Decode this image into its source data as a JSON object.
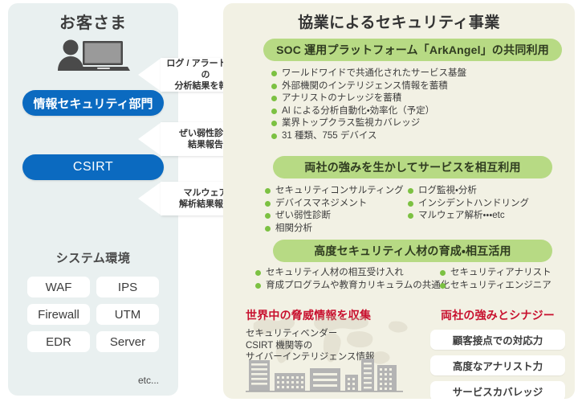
{
  "left": {
    "title": "お客さま",
    "icon_name": "person-at-laptop-icon",
    "departments": [
      {
        "label": "情報セキュリティ部門"
      },
      {
        "label": "CSIRT"
      }
    ],
    "system_env": {
      "title": "システム環境",
      "items": [
        "WAF",
        "IPS",
        "Firewall",
        "UTM",
        "EDR",
        "Server"
      ],
      "etc_label": "etc..."
    }
  },
  "callouts": [
    {
      "text": "ログ / アラート情報の\n分析結果を報告"
    },
    {
      "text": "ぜい弱性診断\n結果報告"
    },
    {
      "text": "マルウェア\n解析結果報告"
    }
  ],
  "right": {
    "title": "協業によるセキュリティ事業",
    "sections": [
      {
        "heading": "SOC 運用プラットフォーム「ArkAngel」の共同利用",
        "columns": [
          [
            "ワールドワイドで共通化されたサービス基盤",
            "外部機関のインテリジェンス情報を蓄積",
            "アナリストのナレッジを蓄積",
            "AI による分析自動化・効率化（予定）",
            "業界トップクラス監視カバレッジ",
            "31 種類、755 デバイス"
          ]
        ]
      },
      {
        "heading": "両社の強みを生かしてサービスを相互利用",
        "columns": [
          [
            "セキュリティコンサルティング",
            "デバイスマネジメント",
            "ぜい弱性診断",
            "相関分析"
          ],
          [
            "ログ監視・分析",
            "インシデントハンドリング",
            "マルウェア解析・・・etc"
          ]
        ]
      },
      {
        "heading": "高度セキュリティ人材の育成・相互活用",
        "columns": [
          [
            "セキュリティ人材の相互受け入れ",
            "育成プログラムや教育カリキュラムの共通化"
          ],
          [
            "セキュリティアナリスト",
            "セキュリティエンジニア"
          ]
        ]
      }
    ],
    "threat": {
      "heading": "世界中の脅威情報を収集",
      "body": "セキュリティベンダー\nCSIRT 機関等の\nサイバーインテリジェンス情報",
      "map_icon": "world-map-watermark",
      "skyline_icon": "city-skyline-icon"
    },
    "synergy": {
      "heading": "両社の強みとシナジー",
      "items": [
        "顧客接点での対応力",
        "高度なアナリスト力",
        "サービスカバレッジ"
      ]
    }
  },
  "colors": {
    "left_panel_bg": "#e9f0f0",
    "right_panel_bg": "#f2f1e4",
    "pill_blue": "#0b6ac0",
    "green_pill": "#b7da84",
    "bullet_green": "#7cc142",
    "red_heading": "#c8102e"
  }
}
